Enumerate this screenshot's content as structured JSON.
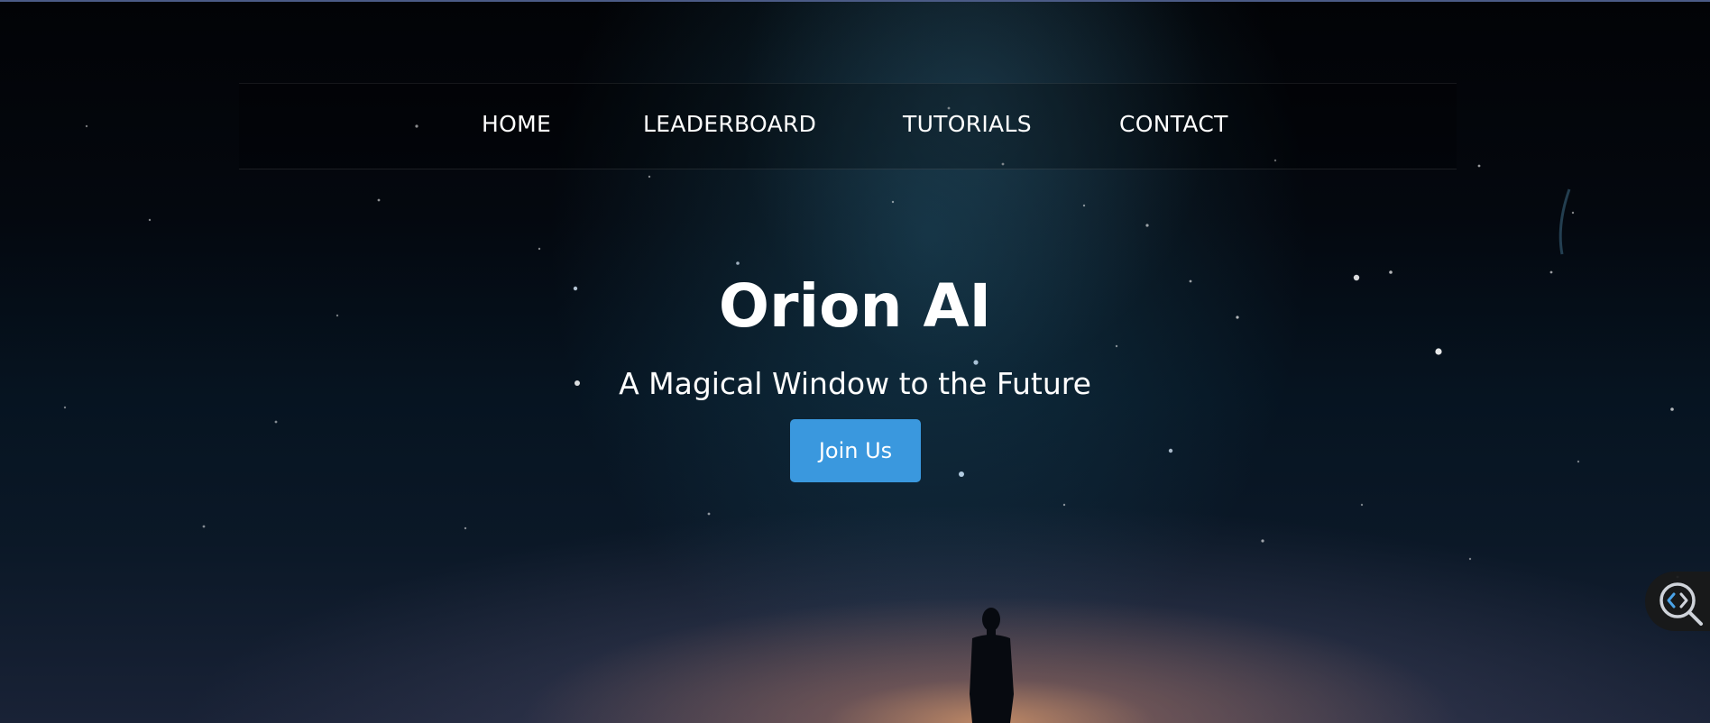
{
  "nav": {
    "items": [
      {
        "label": "HOME"
      },
      {
        "label": "LEADERBOARD"
      },
      {
        "label": "TUTORIALS"
      },
      {
        "label": "CONTACT"
      }
    ]
  },
  "hero": {
    "title": "Orion AI",
    "subtitle": "A Magical Window to the Future",
    "cta_label": "Join Us"
  },
  "colors": {
    "accent": "#3a98de",
    "text": "#ffffff",
    "sky_dark": "#05070b",
    "horizon_glow": "#d69668"
  },
  "icons": {
    "floating_widget": "code-search-icon"
  }
}
